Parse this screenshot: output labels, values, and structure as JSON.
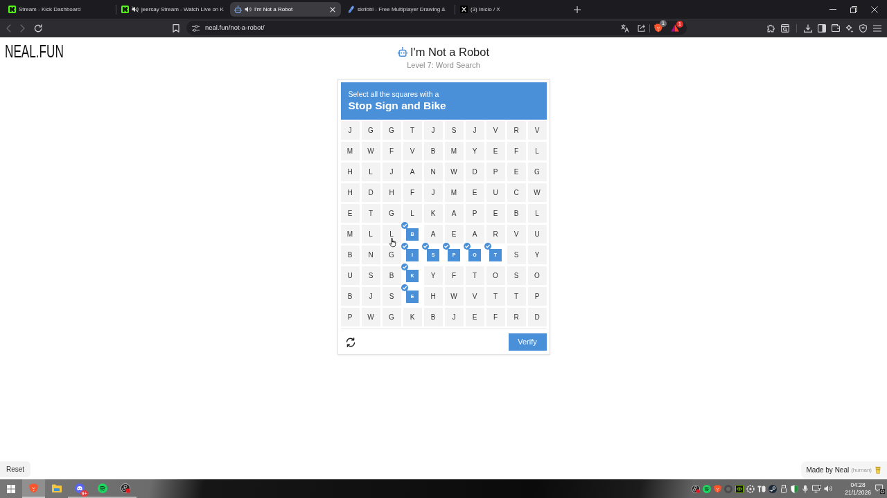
{
  "browser": {
    "tabs": [
      {
        "title": "Stream - Kick Dashboard",
        "selected": false,
        "sound": false
      },
      {
        "title": "jeersay Stream - Watch Live on K",
        "selected": false,
        "sound": true,
        "muted": true
      },
      {
        "title": "I'm Not a Robot",
        "selected": true,
        "sound": true,
        "muted": false
      },
      {
        "title": "skribbl - Free Multiplayer Drawing &",
        "selected": false,
        "sound": false
      },
      {
        "title": "(3) Inicio / X",
        "selected": false,
        "sound": false
      }
    ],
    "back": {
      "disabled": true
    },
    "forward": {
      "disabled": true
    },
    "url": "neal.fun/not-a-robot/",
    "shield_badge": "1",
    "rewards_badge": "1"
  },
  "page": {
    "logo": "NEAL.FUN",
    "title": "I'm Not a Robot",
    "subtitle": "Level 7: Word Search",
    "captcha": {
      "prompt": "Select all the squares with a",
      "target": "Stop Sign and Bike",
      "grid": [
        [
          {
            "letter": "J",
            "selected": false
          },
          {
            "letter": "G",
            "selected": false
          },
          {
            "letter": "G",
            "selected": false
          },
          {
            "letter": "T",
            "selected": false
          },
          {
            "letter": "J",
            "selected": false
          },
          {
            "letter": "S",
            "selected": false
          },
          {
            "letter": "J",
            "selected": false
          },
          {
            "letter": "V",
            "selected": false
          },
          {
            "letter": "R",
            "selected": false
          },
          {
            "letter": "V",
            "selected": false
          }
        ],
        [
          {
            "letter": "M",
            "selected": false
          },
          {
            "letter": "W",
            "selected": false
          },
          {
            "letter": "F",
            "selected": false
          },
          {
            "letter": "V",
            "selected": false
          },
          {
            "letter": "B",
            "selected": false
          },
          {
            "letter": "M",
            "selected": false
          },
          {
            "letter": "Y",
            "selected": false
          },
          {
            "letter": "E",
            "selected": false
          },
          {
            "letter": "F",
            "selected": false
          },
          {
            "letter": "L",
            "selected": false
          }
        ],
        [
          {
            "letter": "H",
            "selected": false
          },
          {
            "letter": "L",
            "selected": false
          },
          {
            "letter": "J",
            "selected": false
          },
          {
            "letter": "A",
            "selected": false
          },
          {
            "letter": "N",
            "selected": false
          },
          {
            "letter": "W",
            "selected": false
          },
          {
            "letter": "D",
            "selected": false
          },
          {
            "letter": "P",
            "selected": false
          },
          {
            "letter": "E",
            "selected": false
          },
          {
            "letter": "G",
            "selected": false
          }
        ],
        [
          {
            "letter": "H",
            "selected": false
          },
          {
            "letter": "D",
            "selected": false
          },
          {
            "letter": "H",
            "selected": false
          },
          {
            "letter": "F",
            "selected": false
          },
          {
            "letter": "J",
            "selected": false
          },
          {
            "letter": "M",
            "selected": false
          },
          {
            "letter": "E",
            "selected": false
          },
          {
            "letter": "U",
            "selected": false
          },
          {
            "letter": "C",
            "selected": false
          },
          {
            "letter": "W",
            "selected": false
          }
        ],
        [
          {
            "letter": "E",
            "selected": false
          },
          {
            "letter": "T",
            "selected": false
          },
          {
            "letter": "G",
            "selected": false
          },
          {
            "letter": "L",
            "selected": false
          },
          {
            "letter": "K",
            "selected": false
          },
          {
            "letter": "A",
            "selected": false
          },
          {
            "letter": "P",
            "selected": false
          },
          {
            "letter": "E",
            "selected": false
          },
          {
            "letter": "B",
            "selected": false
          },
          {
            "letter": "L",
            "selected": false
          }
        ],
        [
          {
            "letter": "M",
            "selected": false
          },
          {
            "letter": "L",
            "selected": false
          },
          {
            "letter": "L",
            "selected": false
          },
          {
            "letter": "B",
            "selected": true
          },
          {
            "letter": "A",
            "selected": false
          },
          {
            "letter": "E",
            "selected": false
          },
          {
            "letter": "A",
            "selected": false
          },
          {
            "letter": "R",
            "selected": false
          },
          {
            "letter": "V",
            "selected": false
          },
          {
            "letter": "U",
            "selected": false
          }
        ],
        [
          {
            "letter": "B",
            "selected": false
          },
          {
            "letter": "N",
            "selected": false
          },
          {
            "letter": "G",
            "selected": false
          },
          {
            "letter": "I",
            "selected": true
          },
          {
            "letter": "S",
            "selected": true
          },
          {
            "letter": "P",
            "selected": true
          },
          {
            "letter": "O",
            "selected": true
          },
          {
            "letter": "T",
            "selected": true
          },
          {
            "letter": "S",
            "selected": false
          },
          {
            "letter": "Y",
            "selected": false
          }
        ],
        [
          {
            "letter": "U",
            "selected": false
          },
          {
            "letter": "S",
            "selected": false
          },
          {
            "letter": "B",
            "selected": false
          },
          {
            "letter": "K",
            "selected": true
          },
          {
            "letter": "Y",
            "selected": false
          },
          {
            "letter": "F",
            "selected": false
          },
          {
            "letter": "T",
            "selected": false
          },
          {
            "letter": "O",
            "selected": false
          },
          {
            "letter": "S",
            "selected": false
          },
          {
            "letter": "O",
            "selected": false
          }
        ],
        [
          {
            "letter": "B",
            "selected": false
          },
          {
            "letter": "J",
            "selected": false
          },
          {
            "letter": "S",
            "selected": false
          },
          {
            "letter": "E",
            "selected": true
          },
          {
            "letter": "H",
            "selected": false
          },
          {
            "letter": "W",
            "selected": false
          },
          {
            "letter": "V",
            "selected": false
          },
          {
            "letter": "T",
            "selected": false
          },
          {
            "letter": "T",
            "selected": false
          },
          {
            "letter": "P",
            "selected": false
          }
        ],
        [
          {
            "letter": "P",
            "selected": false
          },
          {
            "letter": "W",
            "selected": false
          },
          {
            "letter": "G",
            "selected": false
          },
          {
            "letter": "K",
            "selected": false
          },
          {
            "letter": "B",
            "selected": false
          },
          {
            "letter": "J",
            "selected": false
          },
          {
            "letter": "E",
            "selected": false
          },
          {
            "letter": "F",
            "selected": false
          },
          {
            "letter": "R",
            "selected": false
          },
          {
            "letter": "D",
            "selected": false
          }
        ]
      ],
      "verify_button": "Verify"
    },
    "reset_button": "Reset",
    "credit": {
      "text": "Made by Neal",
      "note": "(human)"
    }
  },
  "taskbar": {
    "apps": [
      {
        "selected": true,
        "running": true
      },
      {
        "selected": false,
        "running": false
      },
      {
        "selected": false,
        "running": true,
        "badge": "9+"
      },
      {
        "selected": false,
        "running": true
      },
      {
        "selected": false,
        "running": true
      }
    ],
    "clock": {
      "time": "04:28",
      "date": "21/1/2026"
    }
  }
}
